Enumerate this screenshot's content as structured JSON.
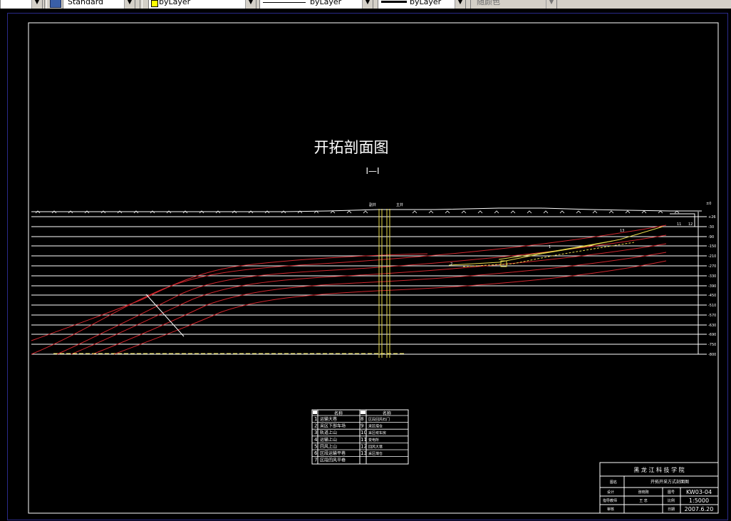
{
  "toolbar": {
    "text_style": "Standard",
    "layer_color": "byLayer",
    "linetype": "byLayer",
    "lineweight": "byLayer",
    "plot_style": "随颜色"
  },
  "drawing": {
    "title": "开拓剖面图",
    "subtitle": "I—I",
    "shaft_labels": [
      "副井",
      "主井"
    ],
    "terrain_label": "±0",
    "elevations": [
      "+26",
      "-30",
      "-90",
      "-150",
      "-210",
      "-270",
      "-330",
      "-390",
      "-450",
      "-510",
      "-570",
      "-630",
      "-690",
      "-750",
      "-800"
    ],
    "layer_labels": [
      "2",
      "1",
      "11",
      "12",
      "13"
    ]
  },
  "legend": {
    "header_name": "名称",
    "items_left": [
      {
        "no": "1",
        "name": "运输大巷"
      },
      {
        "no": "2",
        "name": "采区下部车场"
      },
      {
        "no": "3",
        "name": "轨道上山"
      },
      {
        "no": "4",
        "name": "运输上山"
      },
      {
        "no": "5",
        "name": "回风上山"
      },
      {
        "no": "6",
        "name": "区段运输平巷"
      },
      {
        "no": "7",
        "name": "区段回风平巷"
      }
    ],
    "items_right": [
      {
        "no": "8",
        "name": "区段回风石门"
      },
      {
        "no": "9",
        "name": "采区煤仓"
      },
      {
        "no": "10",
        "name": "采区绞车房"
      },
      {
        "no": "11",
        "name": "变电所"
      },
      {
        "no": "12",
        "name": "回风大巷"
      },
      {
        "no": "13",
        "name": "采区煤仓"
      }
    ]
  },
  "title_block": {
    "school": "黑 龙 江 科 技 学 院",
    "drawing_name_label": "图名",
    "drawing_name": "开拓开采方式剖面图",
    "design_label": "设计",
    "designer": "张晓刚",
    "drawing_no_label": "图号",
    "drawing_no": "KW03-04",
    "teacher_label": "指导教师",
    "teacher": "王 忠",
    "scale_label": "比例",
    "scale": "1:5000",
    "review_label": "审核",
    "date_label": "日期",
    "date": "2007.6.20"
  },
  "colors": {
    "background": "#000000",
    "frame": "#ffffff",
    "seam": "#d1272e",
    "shaft": "#e6d84a",
    "toolbar": "#d4d0c8",
    "viewport_border": "#2a2a8a"
  }
}
